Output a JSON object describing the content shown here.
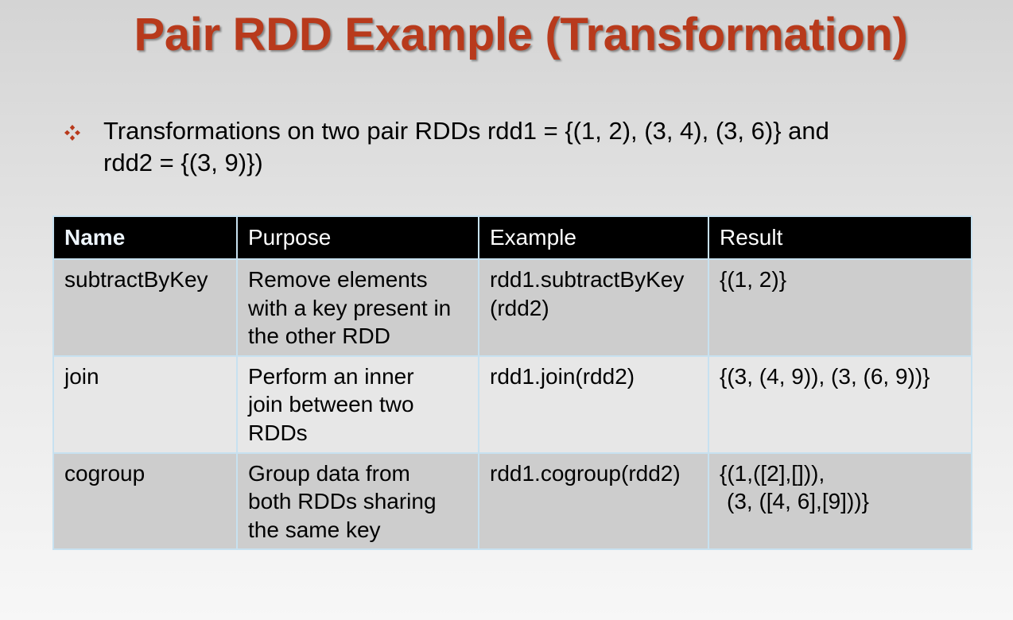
{
  "slide": {
    "title": "Pair RDD Example (Transformation)",
    "bullet_icon": "diamond-bullet-icon",
    "bullet_text_line1": "Transformations on two pair RDDs rdd1 = {(1, 2), (3, 4), (3, 6)} and",
    "bullet_text_line2": "rdd2 = {(3, 9)})"
  },
  "table": {
    "headers": [
      "Name",
      "Purpose",
      "Example",
      "Result"
    ],
    "rows": [
      {
        "name": "subtractByKey",
        "purpose": [
          "Remove elements",
          "with a key present in",
          "the other RDD"
        ],
        "example": [
          "rdd1.subtractByKey",
          "(rdd2)"
        ],
        "result": [
          "{(1, 2)}"
        ]
      },
      {
        "name": "join",
        "purpose": [
          "Perform an inner",
          "join between two",
          "RDDs"
        ],
        "example": [
          "rdd1.join(rdd2)"
        ],
        "result": [
          "{(3, (4, 9)), (3, (6, 9))}"
        ]
      },
      {
        "name": "cogroup",
        "purpose": [
          "Group data from",
          "both RDDs sharing",
          "the same key"
        ],
        "example": [
          "rdd1.cogroup(rdd2)"
        ],
        "result": [
          "{(1,([2],[])),",
          "(3, ([4, 6],[9]))}"
        ]
      }
    ]
  },
  "colors": {
    "title": "#b83a1c",
    "bullet": "#b83a1c",
    "header_bg": "#000000",
    "row_dark": "#cdcdcd",
    "row_light": "#e7e7e7",
    "grid": "#c7e1f0"
  }
}
